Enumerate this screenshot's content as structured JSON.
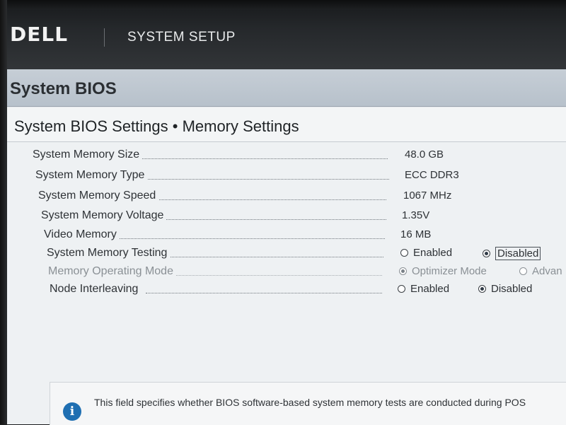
{
  "header": {
    "brand": "DELL",
    "app_title": "SYSTEM SETUP"
  },
  "page": {
    "title": "System BIOS"
  },
  "panel": {
    "title": "System BIOS Settings • Memory Settings",
    "rows": [
      {
        "label": "System Memory Size",
        "value": "48.0 GB"
      },
      {
        "label": "System Memory Type",
        "value": "ECC DDR3"
      },
      {
        "label": "System Memory Speed",
        "value": "1067 MHz"
      },
      {
        "label": "System Memory Voltage",
        "value": "1.35V"
      },
      {
        "label": "Video Memory",
        "value": "16 MB"
      }
    ],
    "memory_testing": {
      "label": "System Memory Testing",
      "option_1": "Enabled",
      "option_2": "Disabled",
      "selected": "Disabled"
    },
    "operating_mode": {
      "label": "Memory Operating Mode",
      "option_1": "Optimizer Mode",
      "option_2": "Advan",
      "selected": "Optimizer Mode",
      "disabled": true
    },
    "node_interleaving": {
      "label": "Node Interleaving",
      "option_1": "Enabled",
      "option_2": "Disabled",
      "selected": "Disabled"
    }
  },
  "help": {
    "icon": "info-icon",
    "text": "This field specifies whether BIOS software-based system memory tests are conducted during POS"
  },
  "colors": {
    "header_dark": "#25282b",
    "title_band": "#bfc8d1",
    "panel_bg": "#eef1f3",
    "info_blue": "#1f6fb2"
  }
}
